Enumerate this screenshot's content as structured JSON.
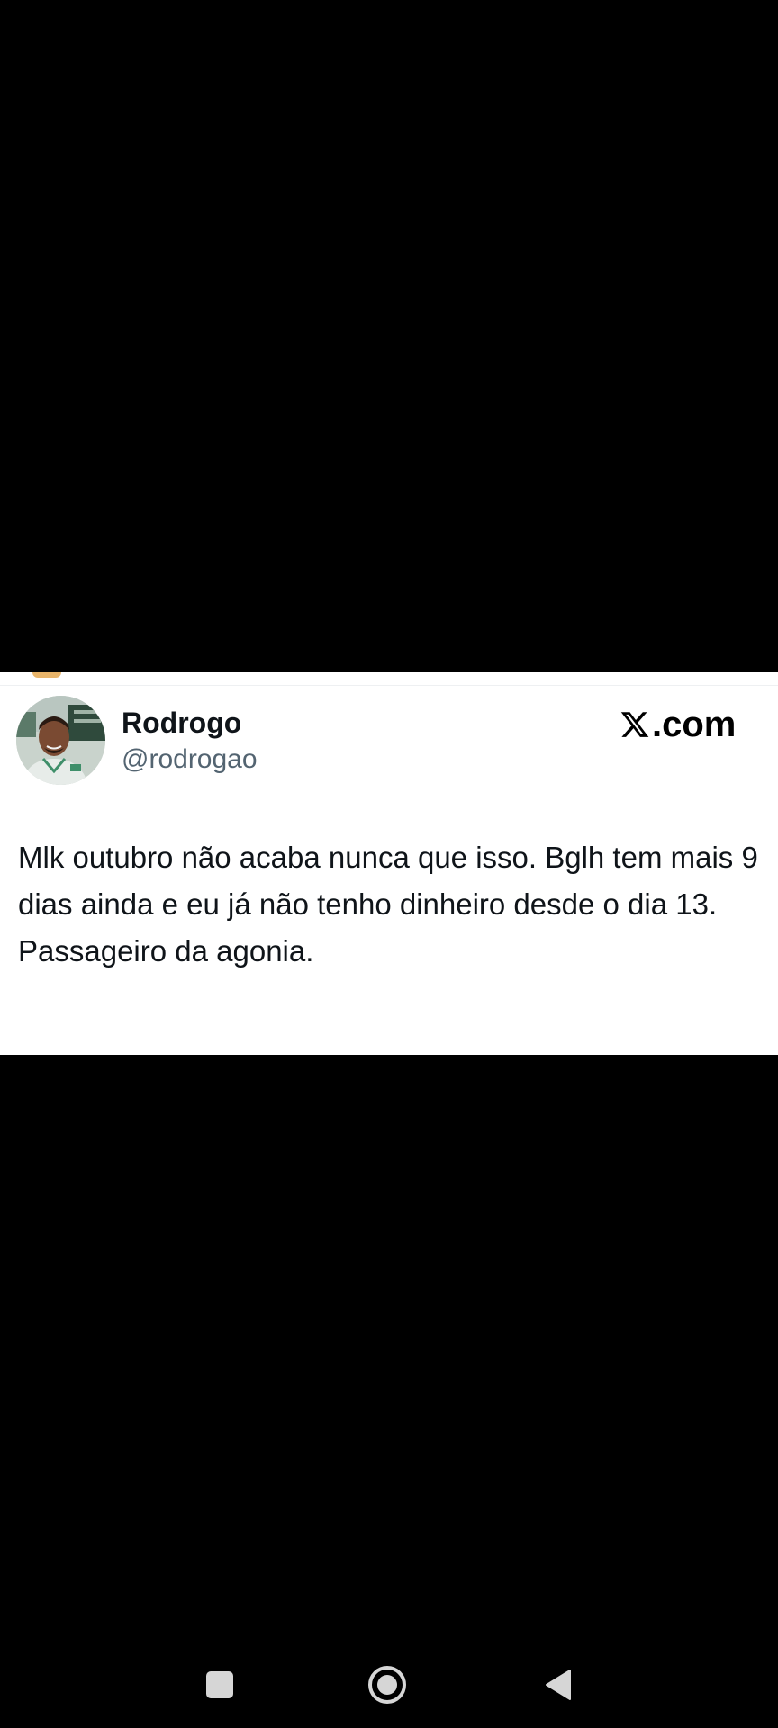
{
  "tweet": {
    "display_name": "Rodrogo",
    "handle": "@rodrogao",
    "brand_suffix": ".com",
    "text_lines": [
      "Mlk outubro não acaba nunca que isso. Bglh tem mais 9 dias ainda e eu já não tenho dinheiro desde o dia 13.",
      "Passageiro da agonia."
    ]
  },
  "icons": {
    "brand": "x-logo-icon",
    "recents": "square-recents-icon",
    "home": "circle-home-icon",
    "back": "triangle-back-icon"
  },
  "colors": {
    "background": "#000000",
    "card": "#ffffff",
    "name_text": "#0f1419",
    "handle_text": "#536471",
    "nav_icon": "#d6d6d6"
  }
}
